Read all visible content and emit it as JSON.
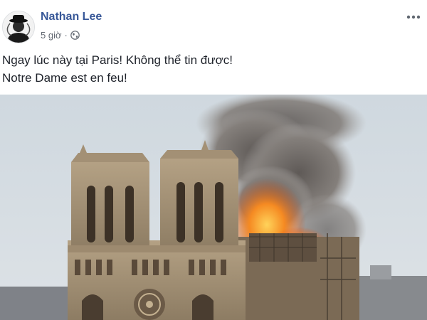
{
  "post": {
    "author": "Nathan Lee",
    "time": "5 giờ",
    "separator": "·",
    "privacy_icon": "globe-icon",
    "more_icon": "more-horizontal-icon",
    "text_lines": [
      "Ngay lúc này tại Paris! Không thể tin được!",
      "Notre Dame est en feu!"
    ],
    "photo": "notre-dame-fire-photo"
  },
  "colors": {
    "author": "#385898",
    "meta": "#616770",
    "text": "#1d2129",
    "fire": "#f07a1e",
    "smoke": "#6f6b68"
  }
}
